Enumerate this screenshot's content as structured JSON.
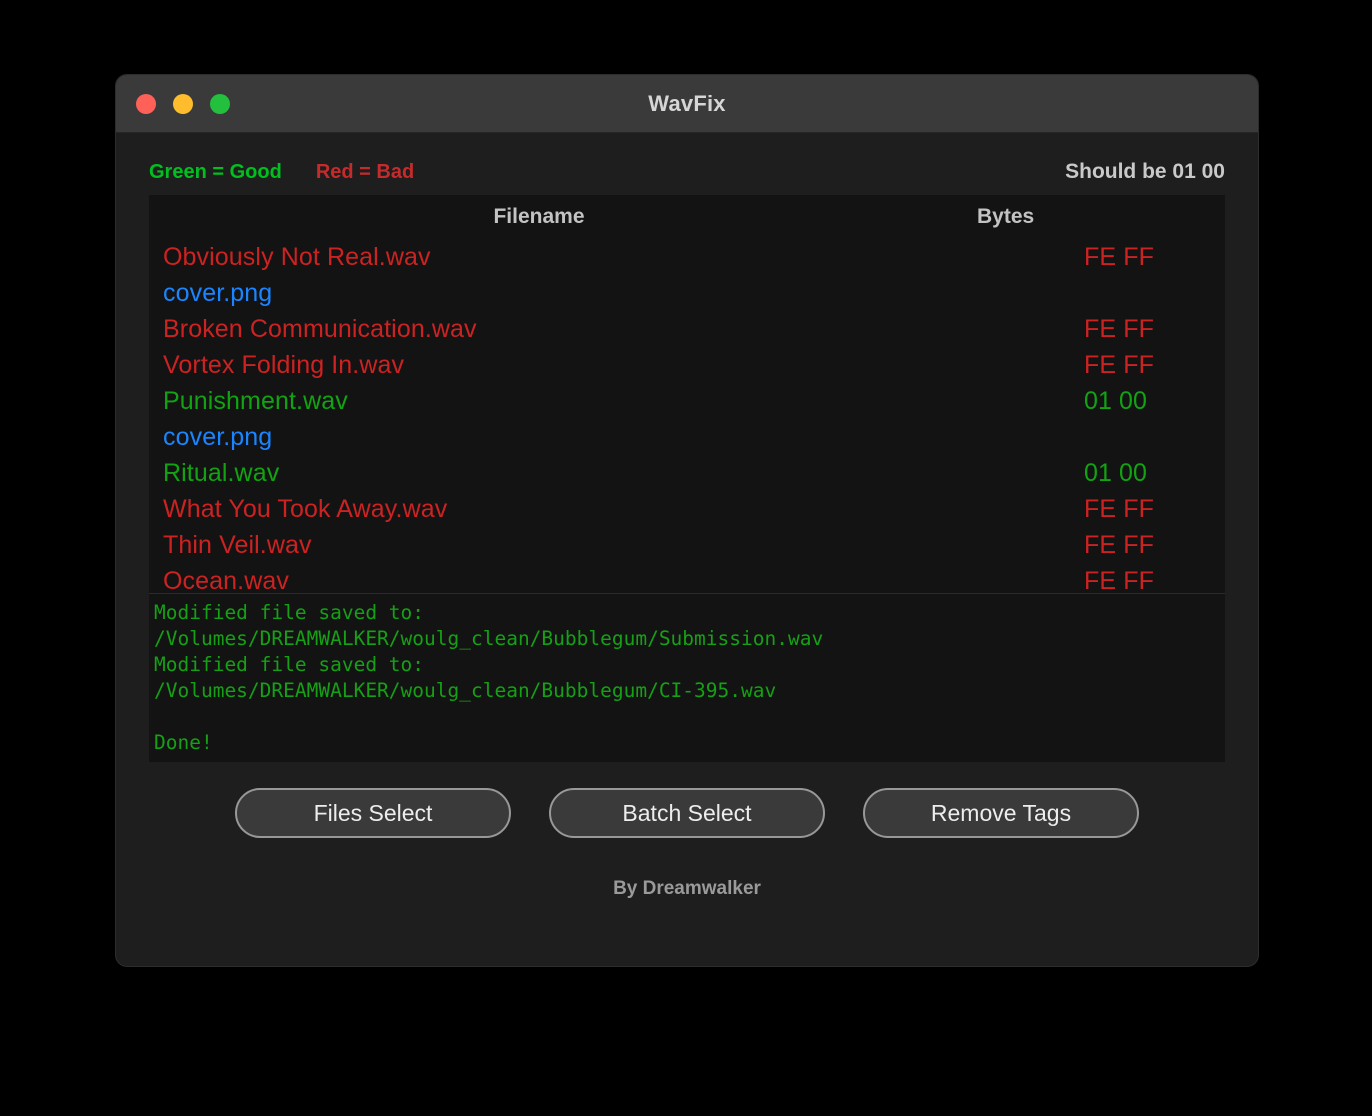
{
  "window": {
    "title": "WavFix",
    "traffic_lights": [
      {
        "name": "close-button",
        "color": "#ff6159"
      },
      {
        "name": "minimize-button",
        "color": "#ffbd2e"
      },
      {
        "name": "maximize-button",
        "color": "#22c03c"
      }
    ]
  },
  "legend": {
    "good": "Green = Good",
    "bad": "Red = Bad",
    "note": "Should be 01 00"
  },
  "table": {
    "headers": {
      "filename": "Filename",
      "bytes": "Bytes"
    },
    "rows": [
      {
        "filename": "Obviously Not Real.wav",
        "bytes": "FE FF",
        "status": "bad"
      },
      {
        "filename": "cover.png",
        "bytes": "",
        "status": "other"
      },
      {
        "filename": "Broken Communication.wav",
        "bytes": "FE FF",
        "status": "bad"
      },
      {
        "filename": "Vortex Folding In.wav",
        "bytes": "FE FF",
        "status": "bad"
      },
      {
        "filename": "Punishment.wav",
        "bytes": "01 00",
        "status": "good"
      },
      {
        "filename": "cover.png",
        "bytes": "",
        "status": "other"
      },
      {
        "filename": "Ritual.wav",
        "bytes": "01 00",
        "status": "good"
      },
      {
        "filename": "What You Took Away.wav",
        "bytes": "FE FF",
        "status": "bad"
      },
      {
        "filename": "Thin Veil.wav",
        "bytes": "FE FF",
        "status": "bad"
      },
      {
        "filename": "Ocean.wav",
        "bytes": "FE FF",
        "status": "bad"
      }
    ]
  },
  "log": {
    "text": "Modified file saved to:\n/Volumes/DREAMWALKER/woulg_clean/Bubblegum/Submission.wav\nModified file saved to:\n/Volumes/DREAMWALKER/woulg_clean/Bubblegum/CI-395.wav\n\nDone!"
  },
  "buttons": {
    "files_select": "Files Select",
    "batch_select": "Batch Select",
    "remove_tags": "Remove Tags"
  },
  "footer": {
    "credit": "By Dreamwalker"
  },
  "colors": {
    "good": "#12a312",
    "bad": "#cc2222",
    "other": "#1a85ff",
    "legend_good": "#00bf1f",
    "legend_bad": "#c62b2b",
    "log": "#15a015",
    "window_bg": "#1e1e1e",
    "panel_bg": "#131313",
    "titlebar_bg": "#3a3a3a"
  }
}
